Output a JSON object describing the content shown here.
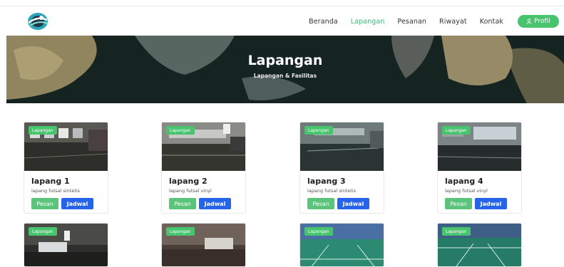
{
  "nav": {
    "links": [
      "Beranda",
      "Lapangan",
      "Pesanan",
      "Riwayat",
      "Kontak"
    ],
    "active": "Lapangan",
    "profil_label": "Profil"
  },
  "hero": {
    "title": "Lapangan",
    "subtitle": "Lapangan & Fasilitas"
  },
  "cards": [
    {
      "badge": "Lapangan",
      "title": "lapang 1",
      "desc": "lapang futsal sintetis",
      "pesan": "Pesan",
      "jadwal": "Jadwal"
    },
    {
      "badge": "Lapangan",
      "title": "lapang 2",
      "desc": "lapang futsal vinyl",
      "pesan": "Pesan",
      "jadwal": "Jadwal"
    },
    {
      "badge": "Lapangan",
      "title": "lapang 3",
      "desc": "lapang futsal sintetis",
      "pesan": "Pesan",
      "jadwal": "Jadwal"
    },
    {
      "badge": "Lapangan",
      "title": "lapang 4",
      "desc": "lapang futsal vinyl",
      "pesan": "Pesan",
      "jadwal": "Jadwal"
    },
    {
      "badge": "Lapangan"
    },
    {
      "badge": "Lapangan"
    },
    {
      "badge": "Lapangan"
    },
    {
      "badge": "Lapangan"
    }
  ],
  "colors": {
    "accent": "#48c46f",
    "primary": "#2563eb",
    "hero_bg": "#1b2a26"
  }
}
